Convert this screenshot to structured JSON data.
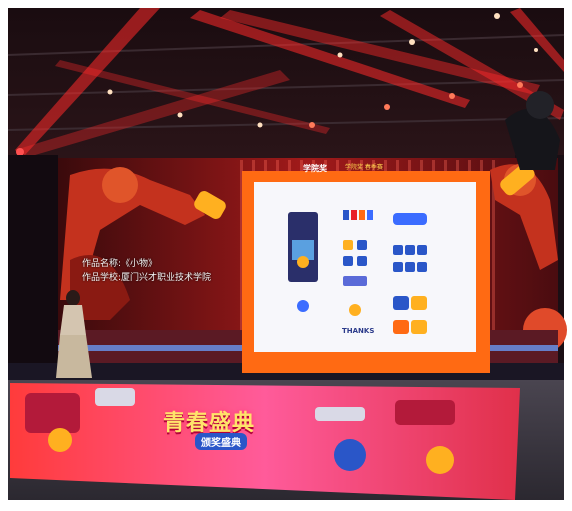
{
  "scene": {
    "screen_captions": [
      {
        "label": "作品名称:",
        "value": "《小物》"
      },
      {
        "label": "作品学校:",
        "value": "厦门兴才职业技术学院"
      }
    ],
    "screen_logo": "学院奖",
    "screen_logo_sub": "学院奖 春季赛",
    "slide_thanks": "THANKS",
    "banner_title": "青春盛典",
    "banner_sub": "颁奖盛典"
  },
  "colors": {
    "stage_red": "#e8202a",
    "slide_border": "#ff6a13",
    "slide_bg": "#f7f7fb",
    "led_blue": "#3b6cff"
  }
}
